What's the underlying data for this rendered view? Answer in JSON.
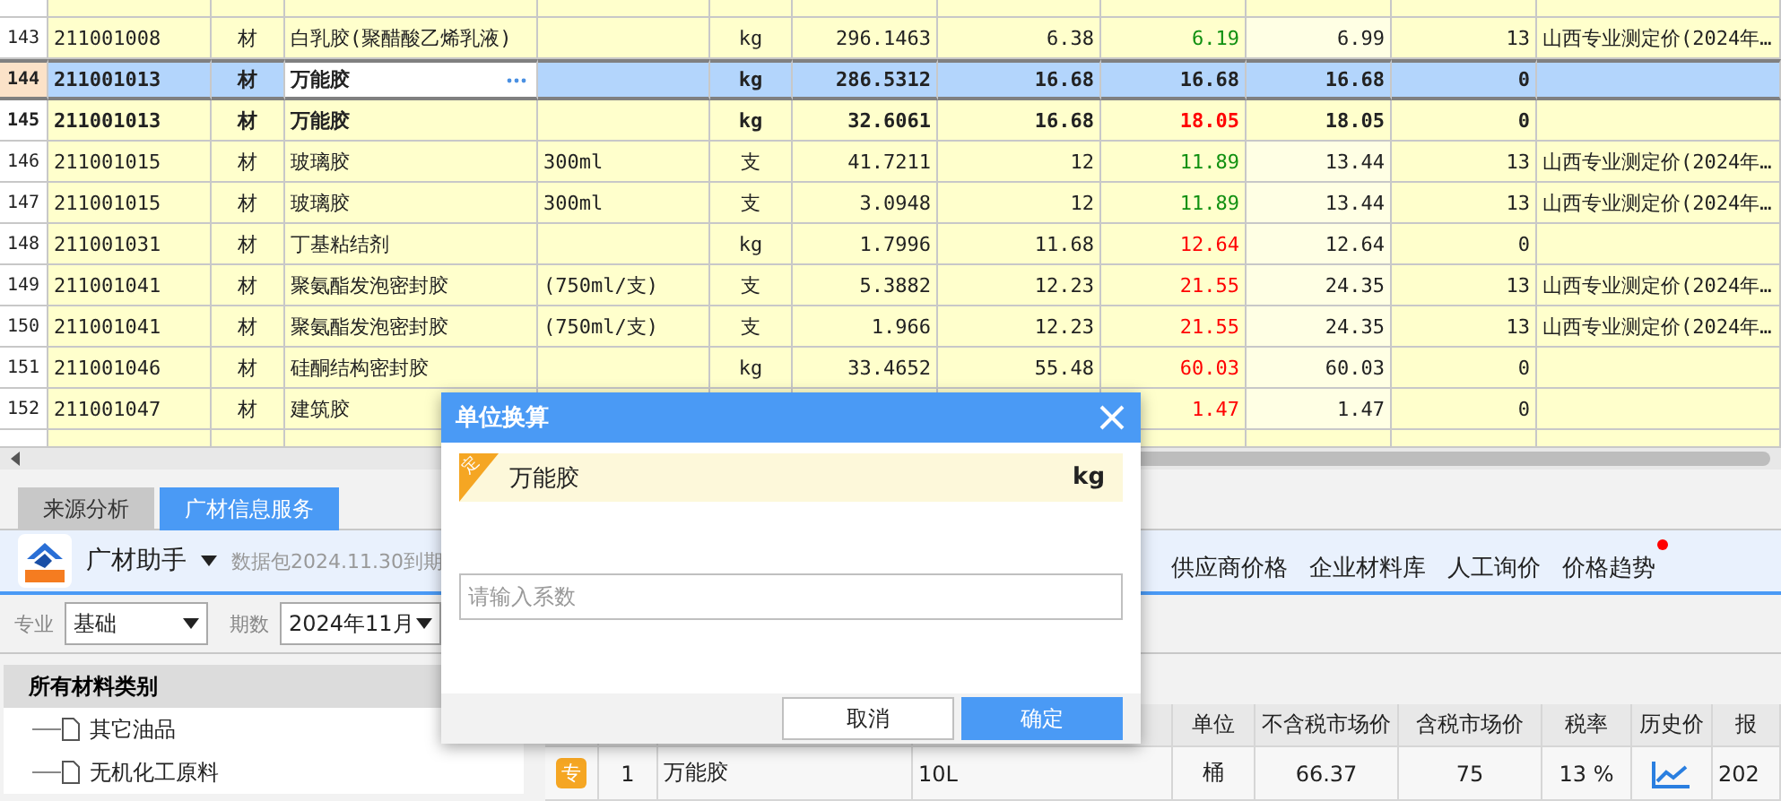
{
  "materials_table": {
    "rows": [
      {
        "number": "143",
        "cells": [
          "211001008",
          "材",
          "白乳胶(聚醋酸乙烯乳液)",
          "",
          "kg",
          "296.1463",
          "6.38",
          "6.19",
          "6.99",
          "13",
          "山西专业测定价(2024年…"
        ],
        "color": "#109010",
        "selected": false,
        "bold": false
      },
      {
        "number": "144",
        "cells": [
          "211001013",
          "材",
          "万能胶",
          "",
          "kg",
          "286.5312",
          "16.68",
          "16.68",
          "16.68",
          "0",
          ""
        ],
        "color": "#222222",
        "selected": true,
        "bold": true
      },
      {
        "number": "145",
        "cells": [
          "211001013",
          "材",
          "万能胶",
          "",
          "kg",
          "32.6061",
          "16.68",
          "18.05",
          "18.05",
          "0",
          ""
        ],
        "color": "#ff0000",
        "selected": false,
        "bold": true
      },
      {
        "number": "146",
        "cells": [
          "211001015",
          "材",
          "玻璃胶",
          "300ml",
          "支",
          "41.7211",
          "12",
          "11.89",
          "13.44",
          "13",
          "山西专业测定价(2024年…"
        ],
        "color": "#109010",
        "selected": false,
        "bold": false
      },
      {
        "number": "147",
        "cells": [
          "211001015",
          "材",
          "玻璃胶",
          "300ml",
          "支",
          "3.0948",
          "12",
          "11.89",
          "13.44",
          "13",
          "山西专业测定价(2024年…"
        ],
        "color": "#109010",
        "selected": false,
        "bold": false
      },
      {
        "number": "148",
        "cells": [
          "211001031",
          "材",
          "丁基粘结剂",
          "",
          "kg",
          "1.7996",
          "11.68",
          "12.64",
          "12.64",
          "0",
          ""
        ],
        "color": "#ff0000",
        "selected": false,
        "bold": false
      },
      {
        "number": "149",
        "cells": [
          "211001041",
          "材",
          "聚氨酯发泡密封胶",
          "(750ml/支)",
          "支",
          "5.3882",
          "12.23",
          "21.55",
          "24.35",
          "13",
          "山西专业测定价(2024年…"
        ],
        "color": "#ff0000",
        "selected": false,
        "bold": false
      },
      {
        "number": "150",
        "cells": [
          "211001041",
          "材",
          "聚氨酯发泡密封胶",
          "(750ml/支)",
          "支",
          "1.966",
          "12.23",
          "21.55",
          "24.35",
          "13",
          "山西专业测定价(2024年…"
        ],
        "color": "#ff0000",
        "selected": false,
        "bold": false
      },
      {
        "number": "151",
        "cells": [
          "211001046",
          "材",
          "硅酮结构密封胶",
          "",
          "kg",
          "33.4652",
          "55.48",
          "60.03",
          "60.03",
          "0",
          ""
        ],
        "color": "#ff0000",
        "selected": false,
        "bold": false
      },
      {
        "number": "152",
        "cells": [
          "211001047",
          "材",
          "建筑胶",
          null,
          null,
          null,
          null,
          "1.47",
          "1.47",
          "0",
          ""
        ],
        "color": "#ff0000",
        "selected": false,
        "bold": false
      }
    ]
  },
  "panel_tabs": [
    {
      "label": "来源分析",
      "selected": false
    },
    {
      "label": "广材信息服务",
      "selected": true
    }
  ],
  "assistant": {
    "name": "广材助手",
    "package_note": "数据包2024.11.30到期",
    "links": [
      {
        "label": "供应商价格",
        "badge": false
      },
      {
        "label": "企业材料库",
        "badge": false
      },
      {
        "label": "人工询价",
        "badge": false
      },
      {
        "label": "价格趋势",
        "badge": true
      }
    ]
  },
  "filters": [
    {
      "label": "专业",
      "value": "基础"
    },
    {
      "label": "期数",
      "value": "2024年11月"
    }
  ],
  "category_tree": {
    "title": "所有材料类别",
    "items": [
      "其它油品",
      "无机化工原料"
    ]
  },
  "price_table": {
    "columns": [
      "单位",
      "不含税市场价",
      "含税市场价",
      "税率",
      "历史价",
      "报"
    ],
    "rows": [
      {
        "tag": "专",
        "number": "1",
        "name": "万能胶",
        "spec": "10L",
        "unit": "桶",
        "price": "66.37",
        "price_with_tax": "75",
        "tax_rate": "13 %",
        "column_6": "202"
      }
    ]
  },
  "dialog": {
    "title": "单位换算",
    "material": {
      "tag": "定",
      "name": "万能胶",
      "unit": "kg"
    },
    "input": {
      "placeholder": "请输入系数"
    },
    "buttons": [
      {
        "label": "取消",
        "primary": false
      },
      {
        "label": "确定",
        "primary": true
      }
    ]
  }
}
